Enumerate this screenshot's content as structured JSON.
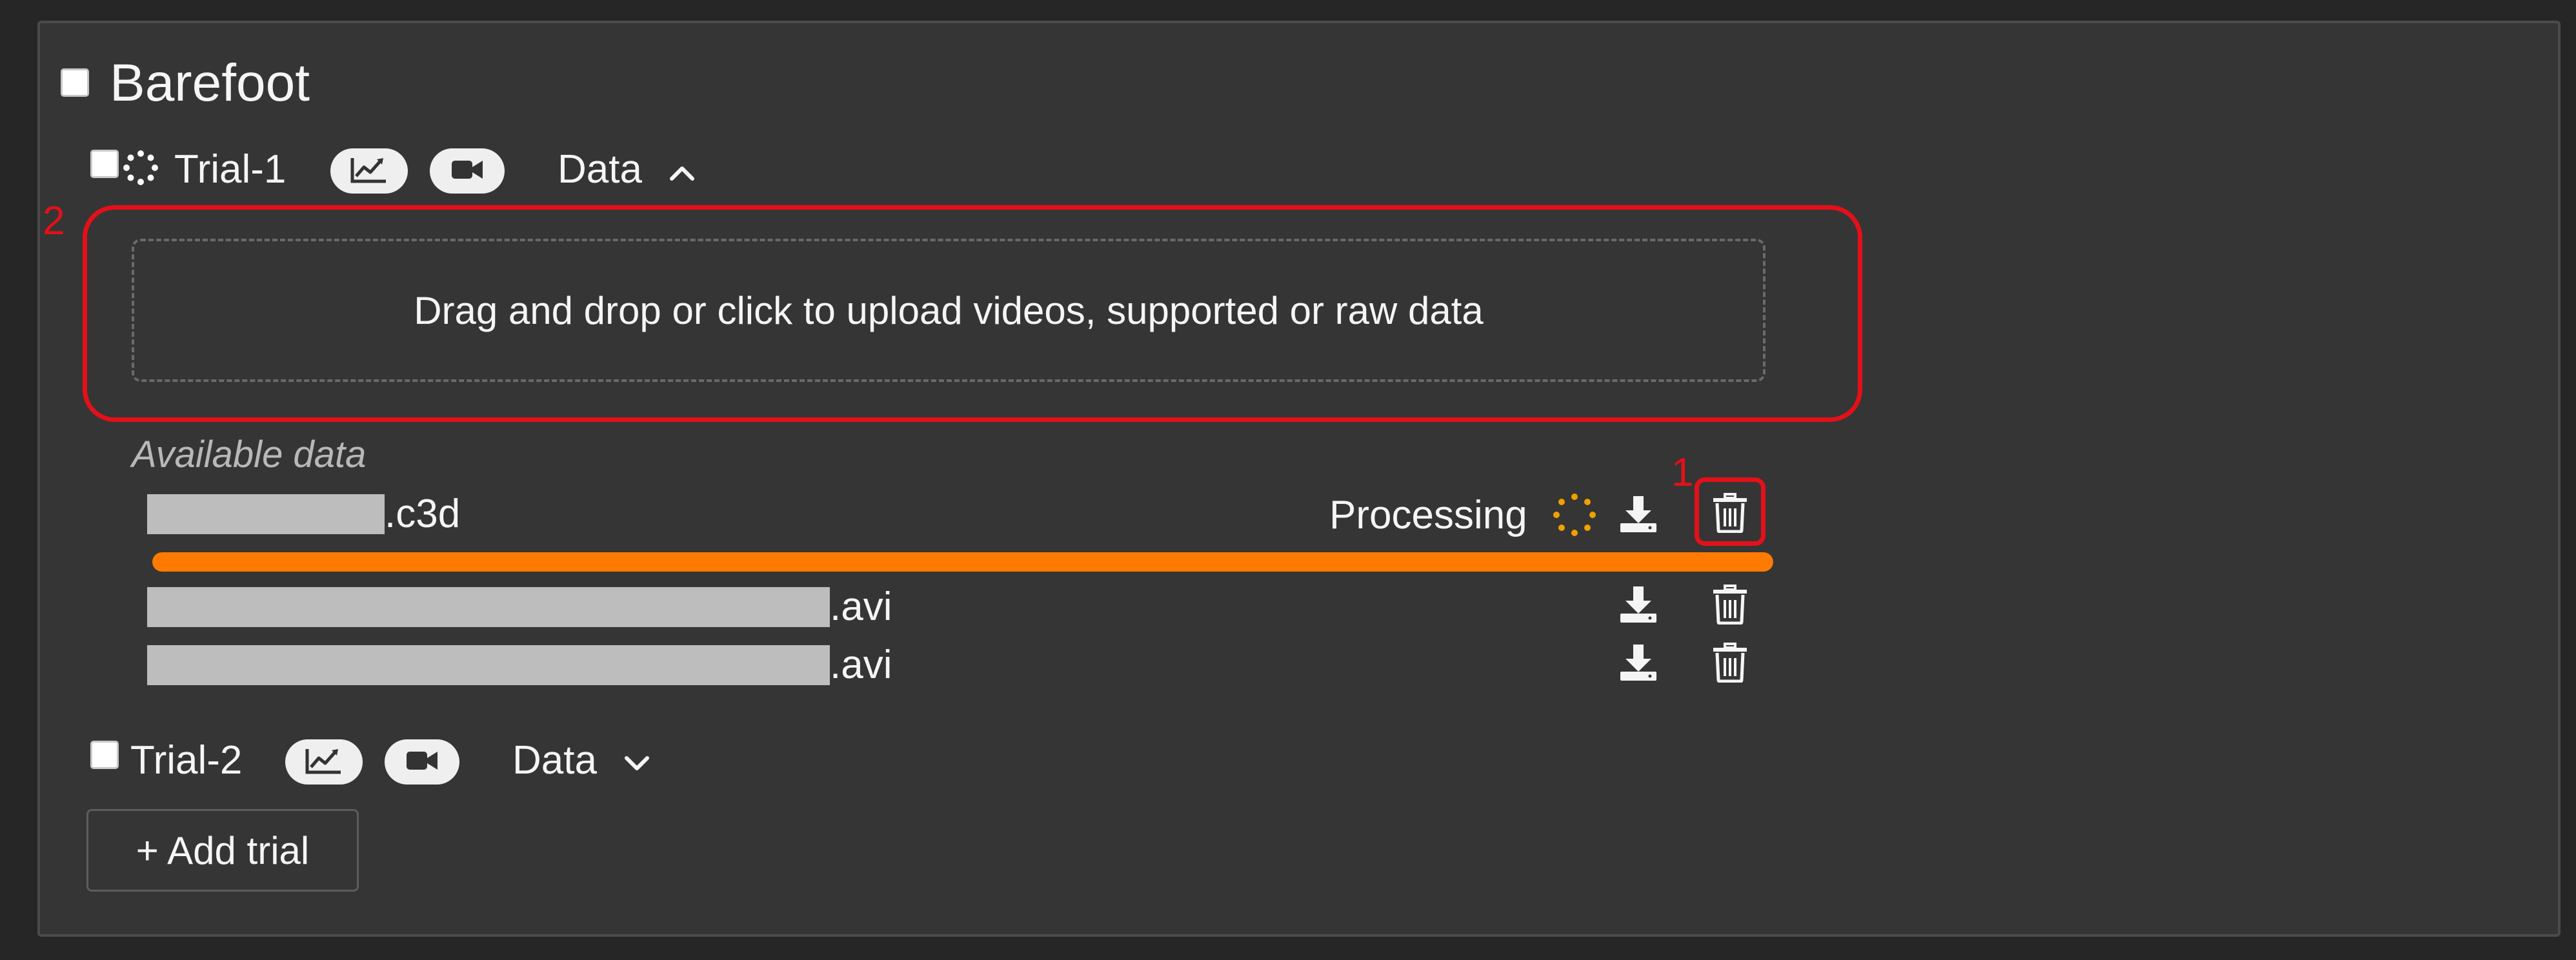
{
  "group": {
    "title": "Barefoot",
    "checked": false
  },
  "trials": [
    {
      "label": "Trial-1",
      "data_toggle_label": "Data",
      "expanded": true,
      "upload_text": "Drag and drop or click to upload videos, supported or raw data",
      "available_label": "Available data",
      "files": [
        {
          "suffix": ".c3d",
          "status": "Processing",
          "progress": 1.0
        },
        {
          "suffix": ".avi",
          "status": ""
        },
        {
          "suffix": ".avi",
          "status": ""
        }
      ]
    },
    {
      "label": "Trial-2",
      "data_toggle_label": "Data",
      "expanded": false
    }
  ],
  "add_trial_label": "+ Add trial",
  "annotations": {
    "delete_marker": "1",
    "dropzone_marker": "2"
  },
  "colors": {
    "annotation": "#e3101a",
    "progress": "#ff7a00",
    "spinner_processing": "#f0a000"
  },
  "icons": {
    "chart": "chart-line-icon",
    "video": "video-camera-icon",
    "chevron_up": "chevron-up-icon",
    "chevron_down": "chevron-down-icon",
    "download": "download-icon",
    "delete": "trash-icon",
    "spinner": "spinner-icon"
  }
}
